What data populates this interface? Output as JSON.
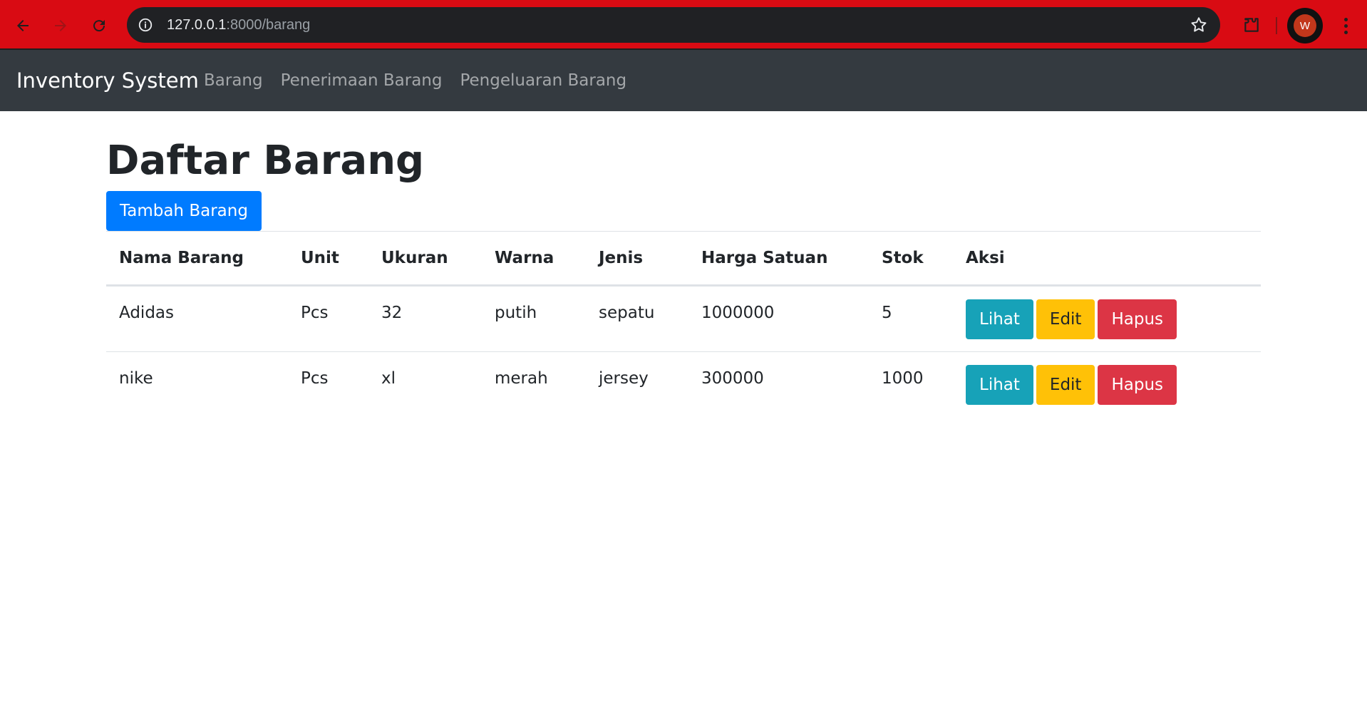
{
  "browser": {
    "url_host": "127.0.0.1",
    "url_path": ":8000/barang",
    "profile_initial": "W"
  },
  "navbar": {
    "brand": "Inventory System",
    "links": [
      "Barang",
      "Penerimaan Barang",
      "Pengeluaran Barang"
    ]
  },
  "page": {
    "title": "Daftar Barang",
    "add_button": "Tambah Barang"
  },
  "table": {
    "headers": [
      "Nama Barang",
      "Unit",
      "Ukuran",
      "Warna",
      "Jenis",
      "Harga Satuan",
      "Stok",
      "Aksi"
    ],
    "rows": [
      {
        "nama": "Adidas",
        "unit": "Pcs",
        "ukuran": "32",
        "warna": "putih",
        "jenis": "sepatu",
        "harga": "1000000",
        "stok": "5"
      },
      {
        "nama": "nike",
        "unit": "Pcs",
        "ukuran": "xl",
        "warna": "merah",
        "jenis": "jersey",
        "harga": "300000",
        "stok": "1000"
      }
    ],
    "actions": {
      "view": "Lihat",
      "edit": "Edit",
      "delete": "Hapus"
    }
  },
  "colors": {
    "chrome": "#d90b13",
    "navbar": "#343a40",
    "primary": "#007bff",
    "info": "#17a2b8",
    "warning": "#ffc107",
    "danger": "#dc3545"
  }
}
